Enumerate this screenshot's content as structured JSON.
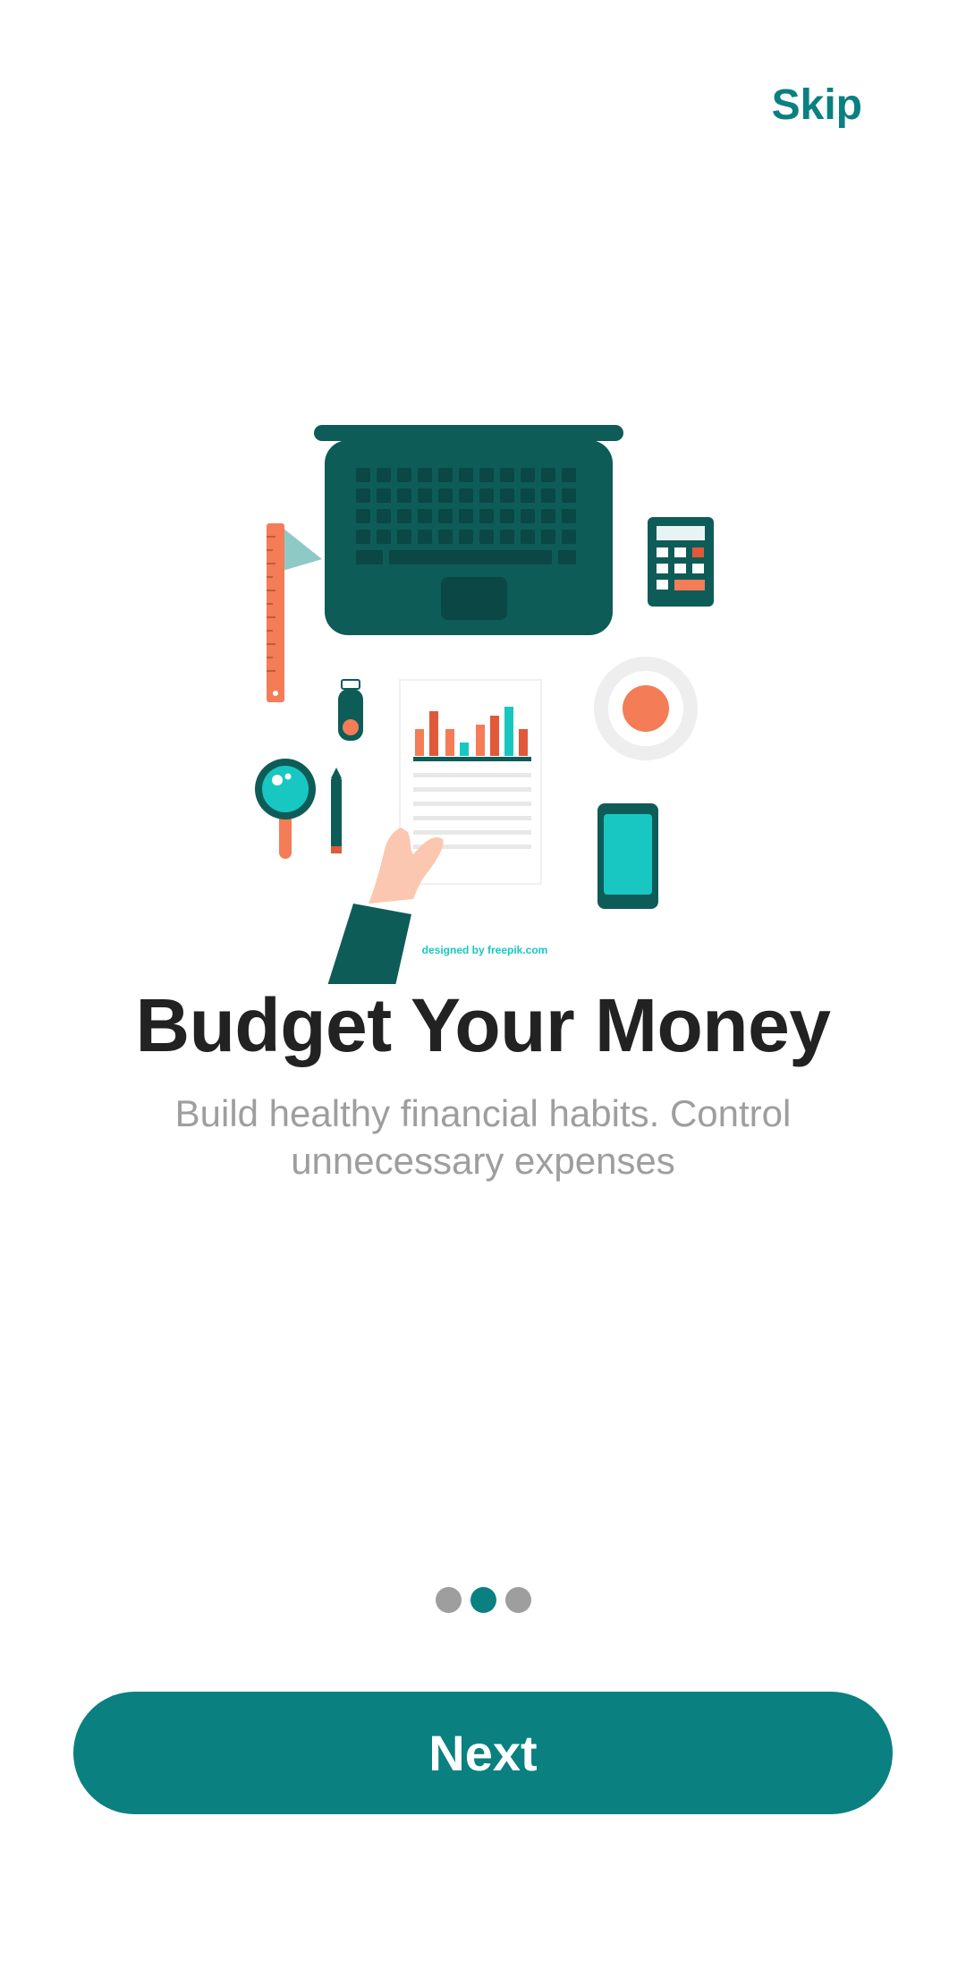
{
  "header": {
    "skip_label": "Skip"
  },
  "onboarding": {
    "title": "Budget Your Money",
    "subtitle": "Build healthy financial habits. Control unnecessary expenses",
    "illustration_credit": "designed by freepik.com",
    "page_indicator": {
      "total": 3,
      "active_index": 1
    }
  },
  "footer": {
    "next_label": "Next"
  },
  "colors": {
    "accent": "#0a8080",
    "title": "#222222",
    "subtitle": "#9e9e9e",
    "inactive_dot": "#9e9e9e",
    "illustration_dark": "#0e5c58",
    "illustration_orange": "#f47c56",
    "illustration_cyan": "#18c7c2"
  },
  "icons": [
    "laptop-icon",
    "calculator-icon",
    "ruler-icon",
    "usb-drive-icon",
    "magnifier-icon",
    "pen-icon",
    "coffee-cup-icon",
    "phone-icon",
    "report-icon",
    "hand-icon"
  ]
}
